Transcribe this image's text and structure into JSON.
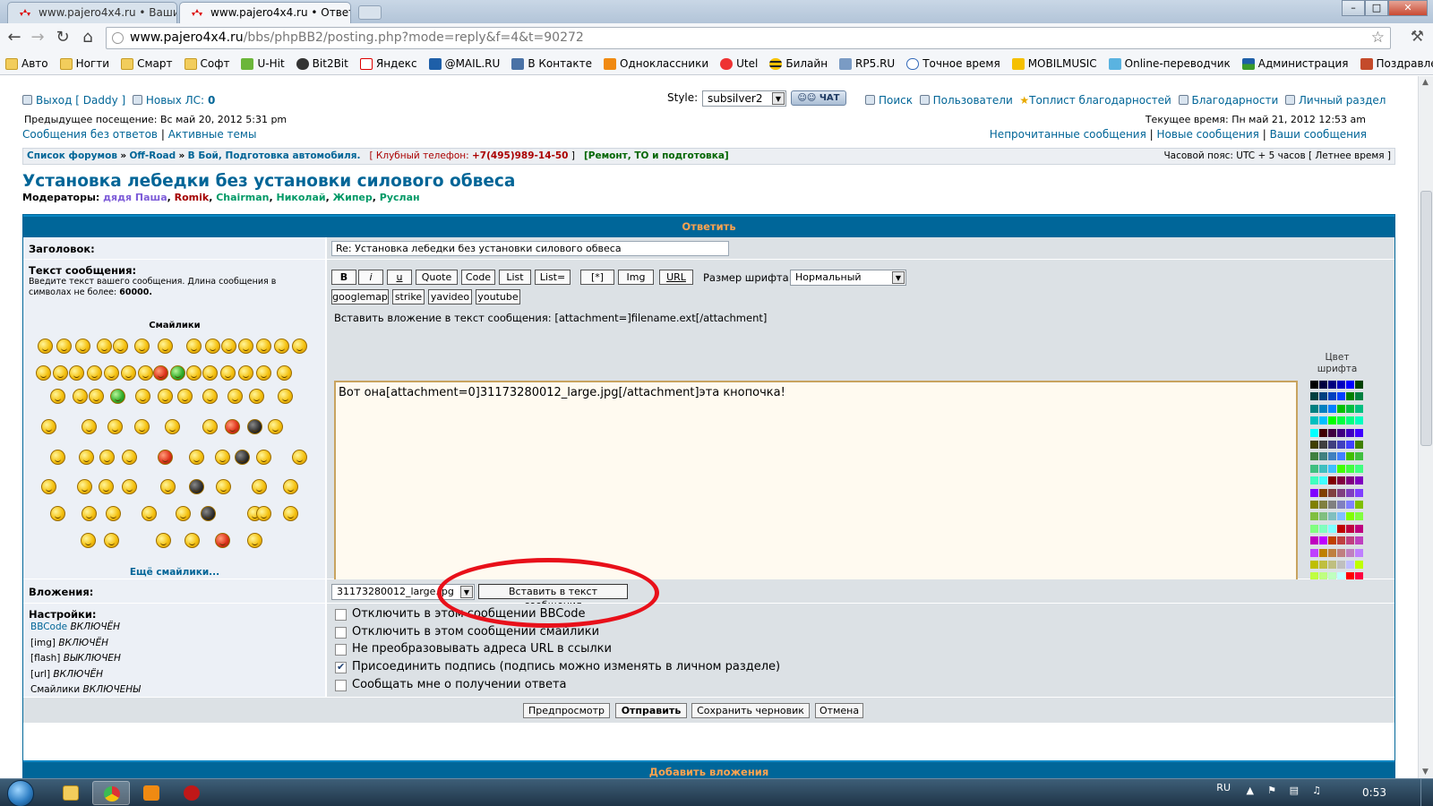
{
  "browser": {
    "tabs": [
      {
        "title": "www.pajero4x4.ru • Ваши с"
      },
      {
        "title": "www.pajero4x4.ru • Ответи"
      }
    ],
    "url_host": "www.pajero4x4.ru",
    "url_path": "/bbs/phpBB2/posting.php?mode=reply&f=4&t=90272",
    "bookmarks": [
      "Авто",
      "Ногти",
      "Смарт",
      "Софт",
      "U-Hit",
      "Bit2Bit",
      "Яндекс",
      "@MAIL.RU",
      "В Контакте",
      "Одноклассники",
      "Utel",
      "Билайн",
      "RP5.RU",
      "Точное время",
      "MOBILMUSIC",
      "Online-переводчик",
      "Администрация",
      "Поздравления"
    ],
    "more": "»"
  },
  "header": {
    "logout": "Выход [ Daddy ]",
    "new_pm_label": "Новых ЛС:",
    "new_pm_count": "0",
    "last_visit": "Предыдущее посещение: Вс май 20, 2012 5:31 pm",
    "unanswered": "Сообщения без ответов",
    "active_topics": "Активные темы",
    "sep": "|",
    "style_label": "Style:",
    "style_value": "subsilver2",
    "chat": "ЧАТ",
    "nav": [
      "Поиск",
      "Пользователи",
      "Топлист благодарностей",
      "Благодарности",
      "Личный раздел"
    ],
    "current_time": "Текущее время: Пн май 21, 2012 12:53 am",
    "unread": "Непрочитанные сообщения",
    "new_posts": "Новые сообщения",
    "your_posts": "Ваши сообщения"
  },
  "breadcrumb": {
    "forum_list": "Список форумов",
    "arrow": "»",
    "offroad": "Off-Road",
    "category": "В Бой, Подготовка автомобиля.",
    "phone_open": "[ Клубный телефон:",
    "phone": "+7(495)989-14-50",
    "phone_close": "]",
    "service": "[Ремонт, ТО и подготовка]",
    "timezone": "Часовой пояс: UTC + 5 часов [ Летнее время ]"
  },
  "forum": {
    "title": "Установка лебедки без установки силового обвеса",
    "moderators_label": "Модераторы:",
    "moderators": [
      {
        "name": "дядя Паша",
        "color": "#7d5cd8"
      },
      {
        "name": "Romik",
        "color": "#a40000"
      },
      {
        "name": "Chairman",
        "color": "#009966"
      },
      {
        "name": "Николай",
        "color": "#009966"
      },
      {
        "name": "Жипер",
        "color": "#009966"
      },
      {
        "name": "Руслан",
        "color": "#009966"
      }
    ]
  },
  "form": {
    "header": "Ответить",
    "subject_label": "Заголовок:",
    "subject_value": "Re: Установка лебедки без установки силового обвеса",
    "text_label": "Текст сообщения:",
    "text_hint": "Введите текст вашего сообщения. Длина сообщения в символах не более:",
    "text_limit": "60000.",
    "smilies_label": "Смайлики",
    "more_smilies": "Ещё смайлики...",
    "bbcode_buttons": [
      "B",
      "i",
      "u",
      "Quote",
      "Code",
      "List",
      "List=",
      "[*]",
      "Img",
      "URL"
    ],
    "font_size_label": "Размер шрифта:",
    "font_size_value": "Нормальный",
    "extra_buttons": [
      "googlemap",
      "strike",
      "yavideo",
      "youtube"
    ],
    "attach_hint": "Вставить вложение в текст сообщения: [attachment=]filename.ext[/attachment]",
    "message": "Вот она[attachment=0]31173280012_large.jpg[/attachment]эта кнопочка!",
    "font_color_label": "Цвет шрифта",
    "attachments_label": "Вложения:",
    "attachment_file": "31173280012_large.jpg",
    "insert_button": "Вставить в текст сообщения",
    "settings_label": "Настройки:",
    "settings_status": [
      {
        "key": "BBCode",
        "state": "ВКЛЮЧЁН"
      },
      {
        "key": "[img]",
        "state": "ВКЛЮЧЁН"
      },
      {
        "key": "[flash]",
        "state": "ВЫКЛЮЧЕН"
      },
      {
        "key": "[url]",
        "state": "ВКЛЮЧЁН"
      },
      {
        "key": "Смайлики",
        "state": "ВКЛЮЧЕНЫ"
      }
    ],
    "options": [
      {
        "label": "Отключить в этом сообщении BBCode",
        "checked": false
      },
      {
        "label": "Отключить в этом сообщении смайлики",
        "checked": false
      },
      {
        "label": "Не преобразовывать адреса URL в ссылки",
        "checked": false
      },
      {
        "label": "Присоединить подпись (подпись можно изменять в личном разделе)",
        "checked": true
      },
      {
        "label": "Сообщать мне о получении ответа",
        "checked": false
      }
    ],
    "actions": [
      "Предпросмотр",
      "Отправить",
      "Сохранить черновик",
      "Отмена"
    ],
    "add_attachments": "Добавить вложения",
    "highlight_color": "#e8101a"
  },
  "taskbar": {
    "lang": "RU",
    "time": "0:53"
  },
  "colors": {
    "accent": "#006699",
    "link": "#006597",
    "header_text": "#ffa34f"
  }
}
